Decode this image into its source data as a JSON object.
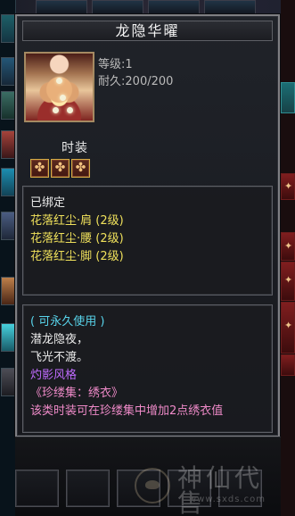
{
  "item": {
    "title": "龙隐华曜",
    "icon_name": "costume-portrait-icon",
    "stats": [
      {
        "label": "等级",
        "value": "1"
      },
      {
        "label": "耐久",
        "value": "200/200"
      }
    ],
    "type_label": "时装",
    "slot_icons": [
      "ornament-icon",
      "ornament-icon",
      "ornament-icon"
    ]
  },
  "binding_box": {
    "bound_text": "已绑定",
    "parts": [
      "花落红尘·肩 (2级)",
      "花落红尘·腰 (2级)",
      "花落红尘·脚 (2级)"
    ]
  },
  "description_box": {
    "usage_text": "( 可永久使用 )",
    "lines": [
      "潜龙隐夜，",
      "飞光不渡。"
    ],
    "style_name": "灼影风格",
    "collection_name": "《珍缕集：绣衣》",
    "collection_effect": "该类时装可在珍缕集中增加2点绣衣值"
  },
  "watermark": {
    "text": "神仙代售",
    "url": "www.sxds.com"
  },
  "colors": {
    "panel_border": "#7f7f83",
    "gold_text": "#efe05b",
    "cyan_text": "#58d4eb",
    "purple_text": "#c06bff",
    "pink_text": "#ee8ac8"
  }
}
